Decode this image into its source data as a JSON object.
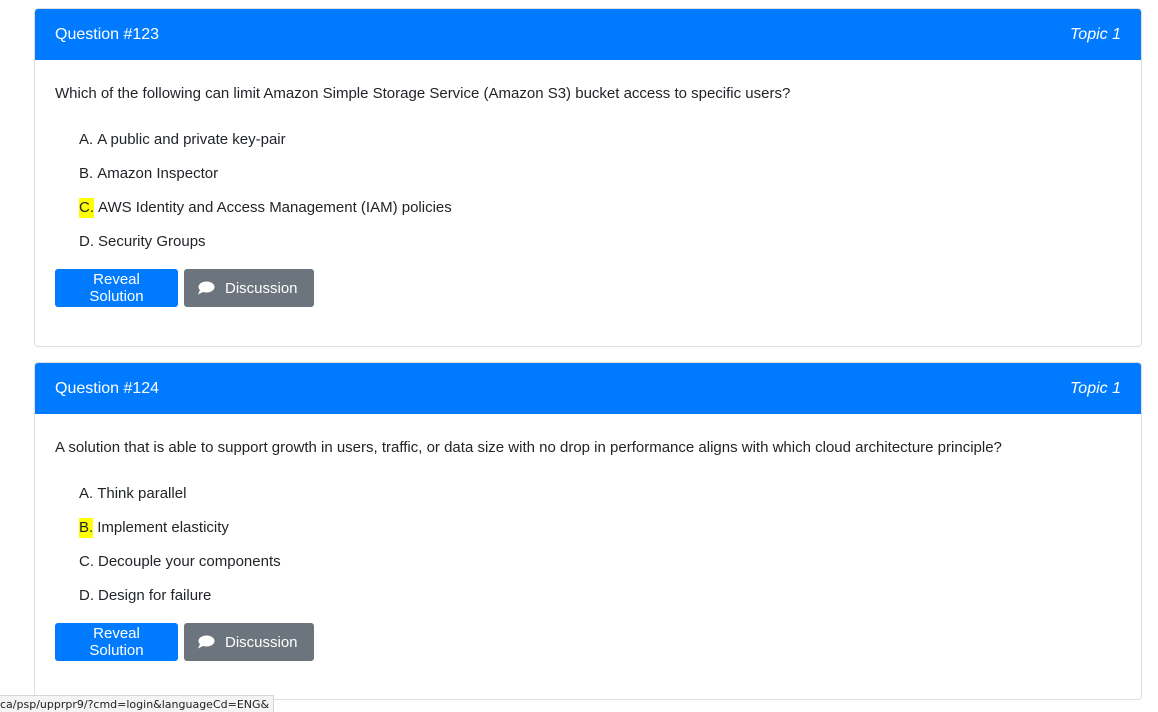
{
  "questions": [
    {
      "title": "Question #123",
      "topic": "Topic 1",
      "text": "Which of the following can limit Amazon Simple Storage Service (Amazon S3) bucket access to specific users?",
      "choices": [
        {
          "letter": "A.",
          "text": "A public and private key-pair",
          "highlighted": false
        },
        {
          "letter": "B.",
          "text": "Amazon Inspector",
          "highlighted": false
        },
        {
          "letter": "C.",
          "text": "AWS Identity and Access Management (IAM) policies",
          "highlighted": true
        },
        {
          "letter": "D.",
          "text": "Security Groups",
          "highlighted": false
        }
      ],
      "reveal_label": "Reveal Solution",
      "discussion_label": "Discussion"
    },
    {
      "title": "Question #124",
      "topic": "Topic 1",
      "text": "A solution that is able to support growth in users, traffic, or data size with no drop in performance aligns with which cloud architecture principle?",
      "choices": [
        {
          "letter": "A.",
          "text": "Think parallel",
          "highlighted": false
        },
        {
          "letter": "B.",
          "text": "Implement elasticity",
          "highlighted": true
        },
        {
          "letter": "C.",
          "text": "Decouple your components",
          "highlighted": false
        },
        {
          "letter": "D.",
          "text": "Design for failure",
          "highlighted": false
        }
      ],
      "reveal_label": "Reveal Solution",
      "discussion_label": "Discussion"
    }
  ],
  "status_bar": {
    "url": "ca/psp/upprpr9/?cmd=login&languageCd=ENG&"
  },
  "colors": {
    "primary": "#007bff",
    "secondary": "#6c757d",
    "highlight": "#ffff00"
  },
  "icons": {
    "discussion": "speech-bubble-icon"
  }
}
